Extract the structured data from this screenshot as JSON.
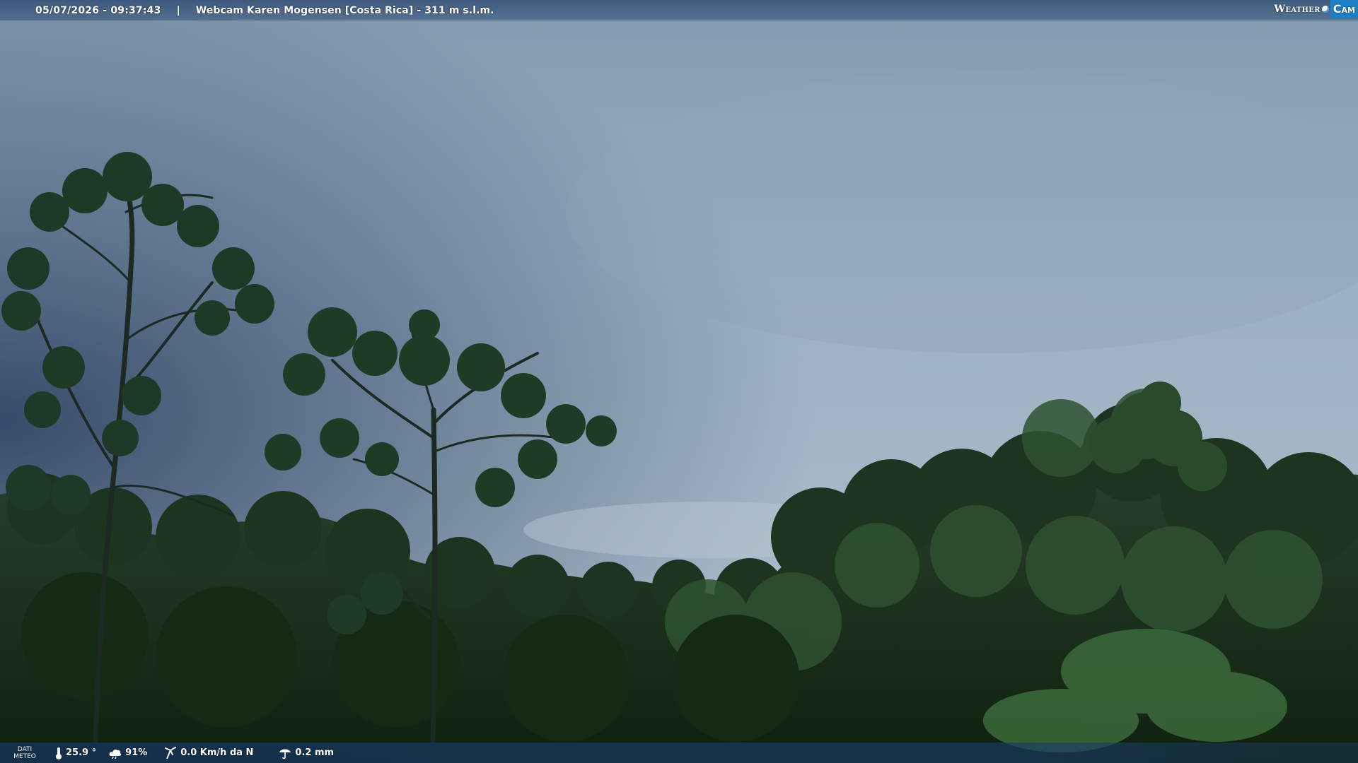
{
  "top_bar": {
    "datetime": "05/07/2026 - 09:37:43",
    "separator": "|",
    "camera_title": "Webcam Karen Mogensen [Costa Rica]  - 311 m s.l.m."
  },
  "logo": {
    "weather_text": "Weather",
    "cam_text": "Cam"
  },
  "bottom_bar": {
    "dati_line1": "DATI",
    "dati_line2": "METEO",
    "temperature": "25.9 °",
    "humidity": "91%",
    "wind": "0.0 Km/h da N",
    "rain": "0.2 mm"
  },
  "icons": {
    "temperature": "thermometer-icon",
    "humidity": "humidity-icon",
    "wind": "wind-icon",
    "rain": "rain-icon"
  },
  "colors": {
    "sky_top": "#8fa6bb",
    "sky_bottom": "#a9bccb",
    "foliage_dark": "#14261a",
    "foliage_mid": "#2b4a2b",
    "logo_cam_bg": "#1f7fc4"
  }
}
